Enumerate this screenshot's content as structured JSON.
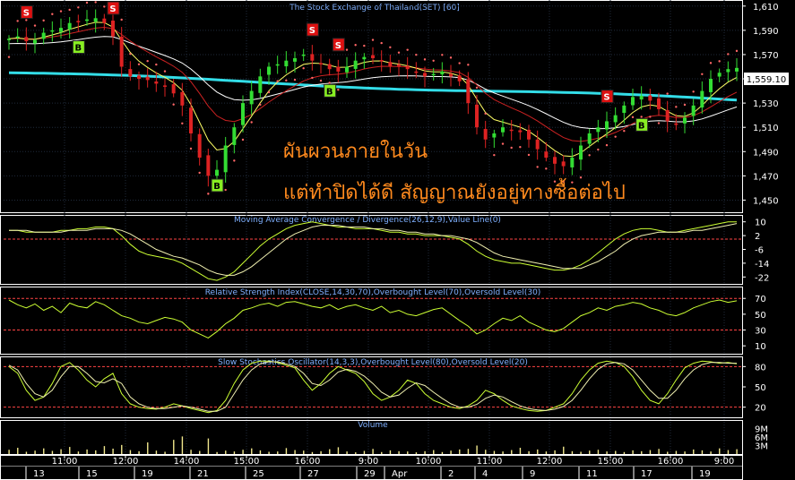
{
  "colors": {
    "background": "#000000",
    "grid": "#1f2a3a",
    "border": "#ffffff",
    "title": "#7fb0ff",
    "candle_up": "#33dd33",
    "candle_down": "#dd2222",
    "ma_fast": "#ffff66",
    "ma_mid": "#cc2222",
    "ma_slow": "#ffffff",
    "ma_long": "#33dde8",
    "sar": "#ff6666",
    "osc_main": "#ccff33",
    "osc_signal": "#f0f0b0",
    "ref_line": "#ff4444",
    "volume": "#f0e68c",
    "sell_badge": "#dd1111",
    "buy_badge": "#88ee22",
    "annotation": "#ff8a1e",
    "last_price_box": "#ffffff"
  },
  "chart_data": [
    {
      "type": "candlestick",
      "title": "The Stock Exchange of Thailand(SET) [60]",
      "ylim": [
        1440,
        1615
      ],
      "yticks": [
        "1,610",
        "1,590",
        "1,570",
        "1,550",
        "1,530",
        "1,510",
        "1,490",
        "1,470",
        "1,450"
      ],
      "last_price": "1,559.10",
      "close": [
        1583,
        1585,
        1581,
        1582,
        1588,
        1590,
        1592,
        1596,
        1597,
        1599,
        1600,
        1596,
        1585,
        1560,
        1552,
        1550,
        1549,
        1546,
        1544,
        1538,
        1528,
        1505,
        1485,
        1470,
        1475,
        1495,
        1510,
        1530,
        1540,
        1552,
        1560,
        1562,
        1565,
        1567,
        1570,
        1565,
        1562,
        1558,
        1556,
        1560,
        1565,
        1568,
        1567,
        1565,
        1560,
        1560,
        1558,
        1555,
        1552,
        1554,
        1556,
        1552,
        1548,
        1530,
        1510,
        1500,
        1505,
        1510,
        1508,
        1506,
        1500,
        1492,
        1485,
        1480,
        1478,
        1485,
        1495,
        1505,
        1510,
        1515,
        1520,
        1528,
        1535,
        1536,
        1532,
        1525,
        1515,
        1512,
        1518,
        1528,
        1540,
        1550,
        1555,
        1558,
        1559
      ],
      "signals": [
        {
          "type": "sell",
          "label": "S",
          "bar": 2
        },
        {
          "type": "sell",
          "label": "S",
          "bar": 12
        },
        {
          "type": "buy",
          "label": "B",
          "bar": 8
        },
        {
          "type": "buy",
          "label": "B",
          "bar": 24
        },
        {
          "type": "sell",
          "label": "S",
          "bar": 35
        },
        {
          "type": "sell",
          "label": "S",
          "bar": 38
        },
        {
          "type": "buy",
          "label": "B",
          "bar": 37
        },
        {
          "type": "sell",
          "label": "S",
          "bar": 69
        },
        {
          "type": "buy",
          "label": "B",
          "bar": 73
        }
      ],
      "annotations": [
        "ผันผวนภายในวัน",
        "แต่ทำปิดได้ดี สัญญาณยังอยู่ทางซื้อต่อไป"
      ]
    },
    {
      "type": "line",
      "title": "Moving Average Convergence / Divergence(26,12,9),Value Line(0)",
      "ylim": [
        -26,
        14
      ],
      "yticks": [
        "10",
        "2",
        "-6",
        "-14",
        "-22"
      ],
      "reference_value": 0,
      "series": [
        {
          "values": [
            5,
            5,
            4,
            4,
            4,
            4,
            5,
            5,
            6,
            6,
            7,
            7,
            6,
            2,
            -3,
            -7,
            -9,
            -10,
            -11,
            -12,
            -14,
            -17,
            -20,
            -23,
            -24,
            -22,
            -19,
            -14,
            -9,
            -4,
            0,
            3,
            6,
            8,
            9,
            10,
            9,
            8,
            7,
            7,
            6,
            6,
            6,
            5,
            4,
            4,
            3,
            3,
            2,
            2,
            2,
            1,
            0,
            -3,
            -7,
            -10,
            -12,
            -13,
            -14,
            -14,
            -15,
            -16,
            -17,
            -18,
            -18,
            -17,
            -15,
            -12,
            -8,
            -4,
            0,
            3,
            5,
            6,
            6,
            5,
            4,
            4,
            5,
            6,
            7,
            8,
            9,
            10,
            10
          ]
        },
        {
          "values": [
            5,
            5,
            5,
            4,
            4,
            4,
            4,
            5,
            5,
            5,
            6,
            6,
            6,
            5,
            3,
            0,
            -3,
            -6,
            -8,
            -10,
            -11,
            -13,
            -15,
            -18,
            -20,
            -21,
            -21,
            -19,
            -16,
            -12,
            -8,
            -4,
            0,
            3,
            5,
            7,
            8,
            8,
            8,
            7,
            7,
            7,
            6,
            6,
            5,
            5,
            4,
            4,
            3,
            3,
            2,
            2,
            1,
            0,
            -2,
            -5,
            -8,
            -10,
            -11,
            -12,
            -13,
            -14,
            -15,
            -16,
            -17,
            -17,
            -17,
            -15,
            -13,
            -10,
            -7,
            -3,
            0,
            2,
            3,
            4,
            4,
            4,
            4,
            5,
            5,
            6,
            7,
            8,
            9
          ]
        }
      ]
    },
    {
      "type": "line",
      "title": "Relative Strength Index(CLOSE,14,30,70),Overbought Level(70),Oversold Level(30)",
      "ylim": [
        0,
        85
      ],
      "yticks": [
        "70",
        "50",
        "30",
        "10"
      ],
      "reference_values": [
        70,
        30
      ],
      "series": [
        {
          "values": [
            68,
            62,
            58,
            63,
            55,
            60,
            52,
            64,
            60,
            58,
            66,
            62,
            55,
            48,
            45,
            40,
            38,
            42,
            46,
            44,
            40,
            30,
            25,
            20,
            28,
            38,
            45,
            55,
            58,
            62,
            64,
            60,
            65,
            66,
            63,
            60,
            58,
            62,
            56,
            60,
            62,
            58,
            55,
            60,
            52,
            55,
            50,
            48,
            52,
            56,
            58,
            50,
            42,
            35,
            25,
            30,
            38,
            45,
            42,
            48,
            40,
            35,
            30,
            28,
            32,
            40,
            48,
            52,
            58,
            55,
            60,
            62,
            65,
            63,
            58,
            55,
            50,
            48,
            52,
            58,
            62,
            66,
            68,
            65,
            67
          ]
        }
      ]
    },
    {
      "type": "line",
      "title": "Slow Stochastics Oscillator(14,3,3),Overbought Level(80),Oversold Level(20)",
      "ylim": [
        5,
        95
      ],
      "yticks": [
        "80",
        "50",
        "20"
      ],
      "reference_values": [
        80,
        20
      ],
      "series": [
        {
          "values": [
            80,
            70,
            45,
            30,
            35,
            55,
            80,
            86,
            75,
            60,
            50,
            62,
            70,
            40,
            25,
            20,
            18,
            17,
            20,
            25,
            22,
            18,
            15,
            12,
            15,
            30,
            55,
            75,
            85,
            88,
            88,
            86,
            82,
            78,
            60,
            45,
            55,
            70,
            80,
            75,
            70,
            58,
            40,
            30,
            35,
            45,
            60,
            55,
            40,
            30,
            25,
            20,
            18,
            22,
            30,
            45,
            40,
            30,
            22,
            18,
            15,
            14,
            15,
            20,
            25,
            40,
            60,
            75,
            85,
            88,
            86,
            80,
            65,
            45,
            30,
            25,
            40,
            60,
            78,
            85,
            88,
            87,
            85,
            86,
            84
          ]
        },
        {
          "values": [
            82,
            75,
            55,
            40,
            35,
            45,
            65,
            80,
            80,
            70,
            58,
            56,
            62,
            55,
            35,
            25,
            20,
            18,
            18,
            20,
            22,
            20,
            17,
            14,
            14,
            20,
            40,
            60,
            75,
            84,
            87,
            87,
            84,
            80,
            70,
            55,
            52,
            60,
            72,
            76,
            73,
            66,
            55,
            42,
            35,
            38,
            48,
            56,
            52,
            42,
            33,
            25,
            20,
            20,
            24,
            33,
            38,
            35,
            28,
            22,
            18,
            16,
            15,
            17,
            21,
            30,
            45,
            62,
            76,
            84,
            86,
            84,
            75,
            60,
            45,
            33,
            33,
            45,
            62,
            75,
            83,
            86,
            86,
            85,
            85
          ]
        }
      ]
    },
    {
      "type": "bar",
      "title": "Volume",
      "ylim": [
        0,
        12
      ],
      "yticks": [
        "9M",
        "6M",
        "3M"
      ],
      "values": [
        1.5,
        2.2,
        0.8,
        1.2,
        2.0,
        1.1,
        1.7,
        2.5,
        0.9,
        1.6,
        1.3,
        2.8,
        1.9,
        3.2,
        1.4,
        1.0,
        4.1,
        1.2,
        0.8,
        5.0,
        6.2,
        1.5,
        1.1,
        5.5,
        0.7,
        1.2,
        0.9,
        1.5,
        2.0,
        1.3,
        0.8,
        0.9,
        2.1,
        1.4,
        1.2,
        0.7,
        1.0,
        1.7,
        2.4,
        0.9,
        0.6,
        1.1,
        1.8,
        0.7,
        1.3,
        1.0,
        0.9,
        0.6,
        1.0,
        1.4,
        0.7,
        1.2,
        1.6,
        1.8,
        3.0,
        1.5,
        1.1,
        0.9,
        1.4,
        2.2,
        1.0,
        1.6,
        0.9,
        1.3,
        2.6,
        1.0,
        0.8,
        1.2,
        1.5,
        0.9,
        1.1,
        0.7,
        1.3,
        1.0,
        1.4,
        1.8,
        0.8,
        1.1,
        0.9,
        1.6,
        1.3,
        0.9,
        2.0,
        1.4,
        1.7
      ]
    }
  ],
  "time_axis": {
    "upper": [
      "11:00",
      "12:00",
      "14:00",
      "15:00",
      "16:00",
      "9:00",
      "10:00",
      "11:00",
      "12:00",
      "15:00",
      "16:00",
      "9:00"
    ],
    "lower": [
      "13",
      "15",
      "19",
      "21",
      "25",
      "27",
      "29",
      "Apr",
      "2",
      "4",
      "9",
      "11",
      "17",
      "19"
    ]
  }
}
